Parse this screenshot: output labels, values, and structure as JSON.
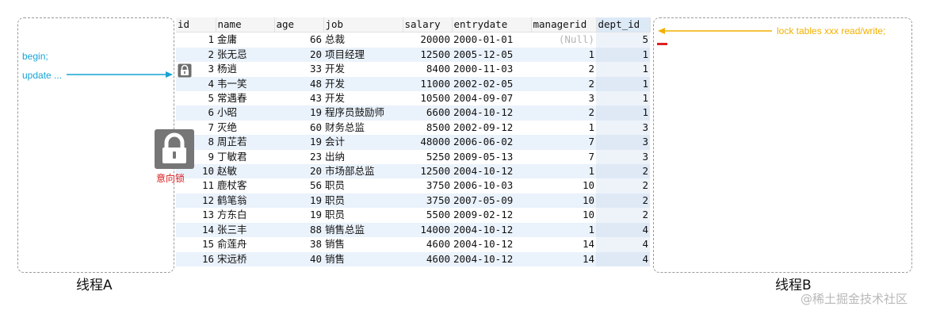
{
  "thread_a": {
    "label": "线程A",
    "lines": [
      "begin;",
      "update ..."
    ]
  },
  "thread_b": {
    "label": "线程B",
    "command": "lock tables xxx read/write;"
  },
  "lock_label": "意向锁",
  "watermark": "@稀土掘金技术社区",
  "colors": {
    "thread_a_text": "#17a3d4",
    "thread_b_text": "#f2b000",
    "lock_label": "#d81e1e",
    "row_highlight": "#eaf2fb"
  },
  "table": {
    "columns": [
      "id",
      "name",
      "age",
      "job",
      "salary",
      "entrydate",
      "managerid",
      "dept_id"
    ],
    "rows": [
      [
        "1",
        "金庸",
        "66",
        "总裁",
        "20000",
        "2000-01-01",
        "(Null)",
        "5"
      ],
      [
        "2",
        "张无忌",
        "20",
        "项目经理",
        "12500",
        "2005-12-05",
        "1",
        "1"
      ],
      [
        "3",
        "杨逍",
        "33",
        "开发",
        "8400",
        "2000-11-03",
        "2",
        "1"
      ],
      [
        "4",
        "韦一笑",
        "48",
        "开发",
        "11000",
        "2002-02-05",
        "2",
        "1"
      ],
      [
        "5",
        "常遇春",
        "43",
        "开发",
        "10500",
        "2004-09-07",
        "3",
        "1"
      ],
      [
        "6",
        "小昭",
        "19",
        "程序员鼓励师",
        "6600",
        "2004-10-12",
        "2",
        "1"
      ],
      [
        "7",
        "灭绝",
        "60",
        "财务总监",
        "8500",
        "2002-09-12",
        "1",
        "3"
      ],
      [
        "8",
        "周芷若",
        "19",
        "会计",
        "48000",
        "2006-06-02",
        "7",
        "3"
      ],
      [
        "9",
        "丁敏君",
        "23",
        "出纳",
        "5250",
        "2009-05-13",
        "7",
        "3"
      ],
      [
        "10",
        "赵敏",
        "20",
        "市场部总监",
        "12500",
        "2004-10-12",
        "1",
        "2"
      ],
      [
        "11",
        "鹿杖客",
        "56",
        "职员",
        "3750",
        "2006-10-03",
        "10",
        "2"
      ],
      [
        "12",
        "鹤笔翁",
        "19",
        "职员",
        "3750",
        "2007-05-09",
        "10",
        "2"
      ],
      [
        "13",
        "方东白",
        "19",
        "职员",
        "5500",
        "2009-02-12",
        "10",
        "2"
      ],
      [
        "14",
        "张三丰",
        "88",
        "销售总监",
        "14000",
        "2004-10-12",
        "1",
        "4"
      ],
      [
        "15",
        "俞莲舟",
        "38",
        "销售",
        "4600",
        "2004-10-12",
        "14",
        "4"
      ],
      [
        "16",
        "宋远桥",
        "40",
        "销售",
        "4600",
        "2004-10-12",
        "14",
        "4"
      ]
    ]
  }
}
